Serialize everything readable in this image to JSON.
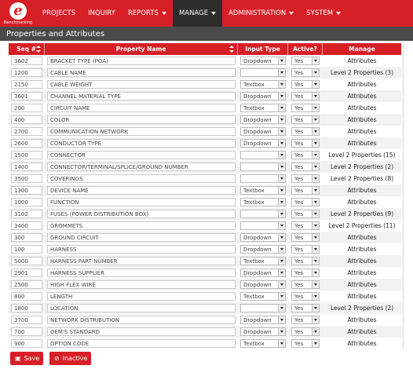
{
  "nav": {
    "logo_text": "Benchmarking",
    "items": [
      {
        "label": "PROJECTS",
        "dropdown": false,
        "active": false
      },
      {
        "label": "INQUIRY",
        "dropdown": false,
        "active": false
      },
      {
        "label": "REPORTS",
        "dropdown": true,
        "active": false
      },
      {
        "label": "MANAGE",
        "dropdown": true,
        "active": true
      },
      {
        "label": "ADMINISTRATION",
        "dropdown": true,
        "active": false
      },
      {
        "label": "SYSTEM",
        "dropdown": true,
        "active": false
      }
    ]
  },
  "page": {
    "title": "Properties and Attributes"
  },
  "table": {
    "headers": {
      "seq": "Seq #",
      "name": "Property Name",
      "type": "Input Type",
      "active": "Active?",
      "manage": "Manage"
    },
    "rows": [
      {
        "seq": "3602",
        "name": "BRACKET TYPE (POA)",
        "type": "Dropdown",
        "active": "Yes",
        "manage": "Attributes"
      },
      {
        "seq": "1200",
        "name": "CABLE NAME",
        "type": "",
        "active": "Yes",
        "manage": "Level 2 Properties (3)"
      },
      {
        "seq": "2150",
        "name": "CABLE WEIGHT",
        "type": "Textbox",
        "active": "Yes",
        "manage": "Attributes"
      },
      {
        "seq": "3601",
        "name": "CHANNEL MATERIAL TYPE",
        "type": "Dropdown",
        "active": "Yes",
        "manage": "Attributes"
      },
      {
        "seq": "200",
        "name": "CIRCUIT NAME",
        "type": "Textbox",
        "active": "Yes",
        "manage": "Attributes"
      },
      {
        "seq": "400",
        "name": "COLOR",
        "type": "Dropdown",
        "active": "Yes",
        "manage": "Attributes"
      },
      {
        "seq": "2700",
        "name": "COMMUNICATION NETWORK",
        "type": "Dropdown",
        "active": "Yes",
        "manage": "Attributes"
      },
      {
        "seq": "2600",
        "name": "CONDUCTOR TYPE",
        "type": "Dropdown",
        "active": "Yes",
        "manage": "Attributes"
      },
      {
        "seq": "1500",
        "name": "CONNECTOR",
        "type": "",
        "active": "Yes",
        "manage": "Level 2 Properties (15)"
      },
      {
        "seq": "1400",
        "name": "CONNECTOR/TERMINAL/SPLICE/GROUND NUMBER",
        "type": "",
        "active": "Yes",
        "manage": "Level 2 Properties (2)"
      },
      {
        "seq": "3500",
        "name": "COVERINGS",
        "type": "",
        "active": "Yes",
        "manage": "Level 2 Properties (8)"
      },
      {
        "seq": "1300",
        "name": "DEVICE NAME",
        "type": "Textbox",
        "active": "Yes",
        "manage": "Attributes"
      },
      {
        "seq": "1000",
        "name": "FUNCTION",
        "type": "Textbox",
        "active": "Yes",
        "manage": "Attributes"
      },
      {
        "seq": "3102",
        "name": "FUSES (POWER DISTRIBUTION BOX)",
        "type": "",
        "active": "Yes",
        "manage": "Level 2 Properties (9)"
      },
      {
        "seq": "3400",
        "name": "GROMMETS",
        "type": "",
        "active": "Yes",
        "manage": "Level 2 Properties (11)"
      },
      {
        "seq": "300",
        "name": "GROUND CIRCUIT",
        "type": "Dropdown",
        "active": "Yes",
        "manage": "Attributes"
      },
      {
        "seq": "100",
        "name": "HARNESS",
        "type": "Dropdown",
        "active": "Yes",
        "manage": "Attributes"
      },
      {
        "seq": "5000",
        "name": "HARNESS PART NUMBER",
        "type": "Textbox",
        "active": "Yes",
        "manage": "Attributes"
      },
      {
        "seq": "2901",
        "name": "HARNESS SUPPLIER",
        "type": "Dropdown",
        "active": "Yes",
        "manage": "Attributes"
      },
      {
        "seq": "2500",
        "name": "HIGH FLEX WIRE",
        "type": "Dropdown",
        "active": "Yes",
        "manage": "Attributes"
      },
      {
        "seq": "800",
        "name": "LENGTH",
        "type": "Textbox",
        "active": "Yes",
        "manage": "Attributes"
      },
      {
        "seq": "1800",
        "name": "LOCATION",
        "type": "",
        "active": "Yes",
        "manage": "Level 2 Properties (2)"
      },
      {
        "seq": "3700",
        "name": "NETWORK DISTRIBUTION",
        "type": "Dropdown",
        "active": "Yes",
        "manage": "Attributes"
      },
      {
        "seq": "700",
        "name": "OEM'S STANDARD",
        "type": "Dropdown",
        "active": "Yes",
        "manage": "Attributes"
      },
      {
        "seq": "900",
        "name": "OPTION CODE",
        "type": "Textbox",
        "active": "Yes",
        "manage": "Attributes"
      }
    ]
  },
  "actions": {
    "save_label": "Save",
    "inactive_label": "Inactive"
  },
  "colors": {
    "brand": "#d71f26",
    "active_nav": "#2c2c2c",
    "title_bar": "#4a4a4a"
  }
}
